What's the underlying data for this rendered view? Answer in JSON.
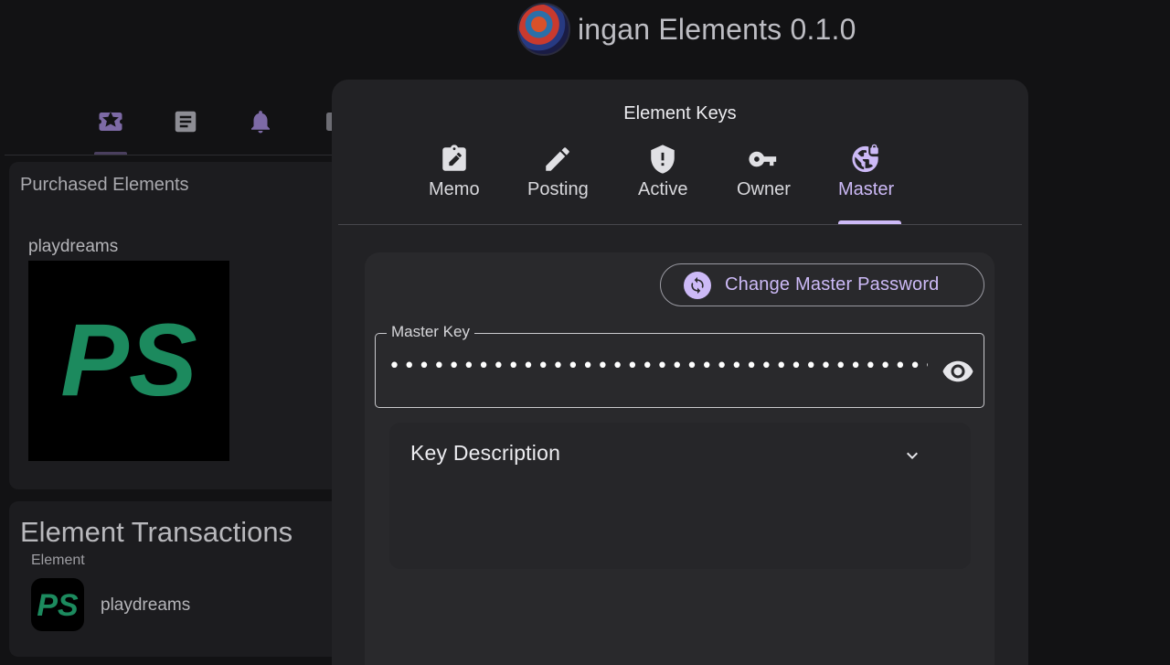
{
  "header": {
    "title": "ingan Elements 0.1.0",
    "logo_icon": "app-logo"
  },
  "nav_tabs": [
    {
      "icon": "ticket-star-icon",
      "active": true
    },
    {
      "icon": "document-icon",
      "active": false
    },
    {
      "icon": "bell-icon",
      "active": false
    },
    {
      "icon": "partial-icon",
      "active": false
    }
  ],
  "purchased": {
    "title": "Purchased Elements",
    "items": [
      {
        "name": "playdreams",
        "logo_text": "PS"
      }
    ]
  },
  "transactions": {
    "title": "Element Transactions",
    "column": "Element",
    "rows": [
      {
        "name": "playdreams",
        "logo_text": "PS"
      }
    ]
  },
  "dialog": {
    "title": "Element Keys",
    "tabs": [
      {
        "label": "Memo",
        "icon": "clipboard-edit-icon"
      },
      {
        "label": "Posting",
        "icon": "pencil-icon"
      },
      {
        "label": "Active",
        "icon": "shield-alert-icon"
      },
      {
        "label": "Owner",
        "icon": "key-icon"
      },
      {
        "label": "Master",
        "icon": "globe-lock-icon"
      }
    ],
    "active_tab": "Master",
    "change_button": "Change Master Password",
    "key_field": {
      "label": "Master Key",
      "value": "••••••••••••••••••••••••••••••••••••••••••••••••••••"
    },
    "description": {
      "title": "Key Description"
    }
  },
  "colors": {
    "accent": "#cdbaf7",
    "background": "#121214",
    "dialog": "#222225",
    "brand_green": "#1c8a5e"
  }
}
